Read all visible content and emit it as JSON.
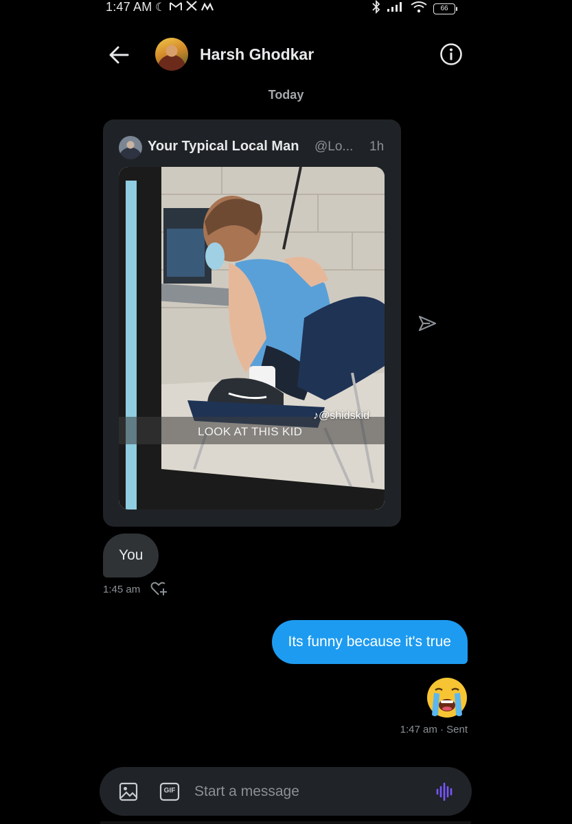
{
  "status_bar": {
    "time": "1:47 AM",
    "left_icons": [
      "moon-icon",
      "gmail-icon",
      "x-icon",
      "m-icon"
    ],
    "right_icons": [
      "bluetooth-icon",
      "signal-icon",
      "wifi-icon"
    ],
    "battery": "66"
  },
  "header": {
    "contact_name": "Harsh Ghodkar"
  },
  "conversation": {
    "date_label": "Today",
    "shared_post": {
      "author": "Your Typical Local Man",
      "handle": "@Lo...",
      "time": "1h",
      "media_watermark": "@shidskid",
      "media_caption": "LOOK AT THIS KID"
    },
    "received": {
      "text": "You",
      "time": "1:45 am"
    },
    "sent": {
      "text": "Its funny because it's true",
      "emoji": "crying-face",
      "meta": "1:47 am · Sent"
    }
  },
  "composer": {
    "placeholder": "Start a message",
    "gif_label": "GIF"
  },
  "colors": {
    "background": "#000000",
    "accent": "#1d9bf0",
    "bubble_received": "#2f3336",
    "card": "#1f2327",
    "muted_text": "#8b9196",
    "voice_accent": "#7856ff"
  }
}
